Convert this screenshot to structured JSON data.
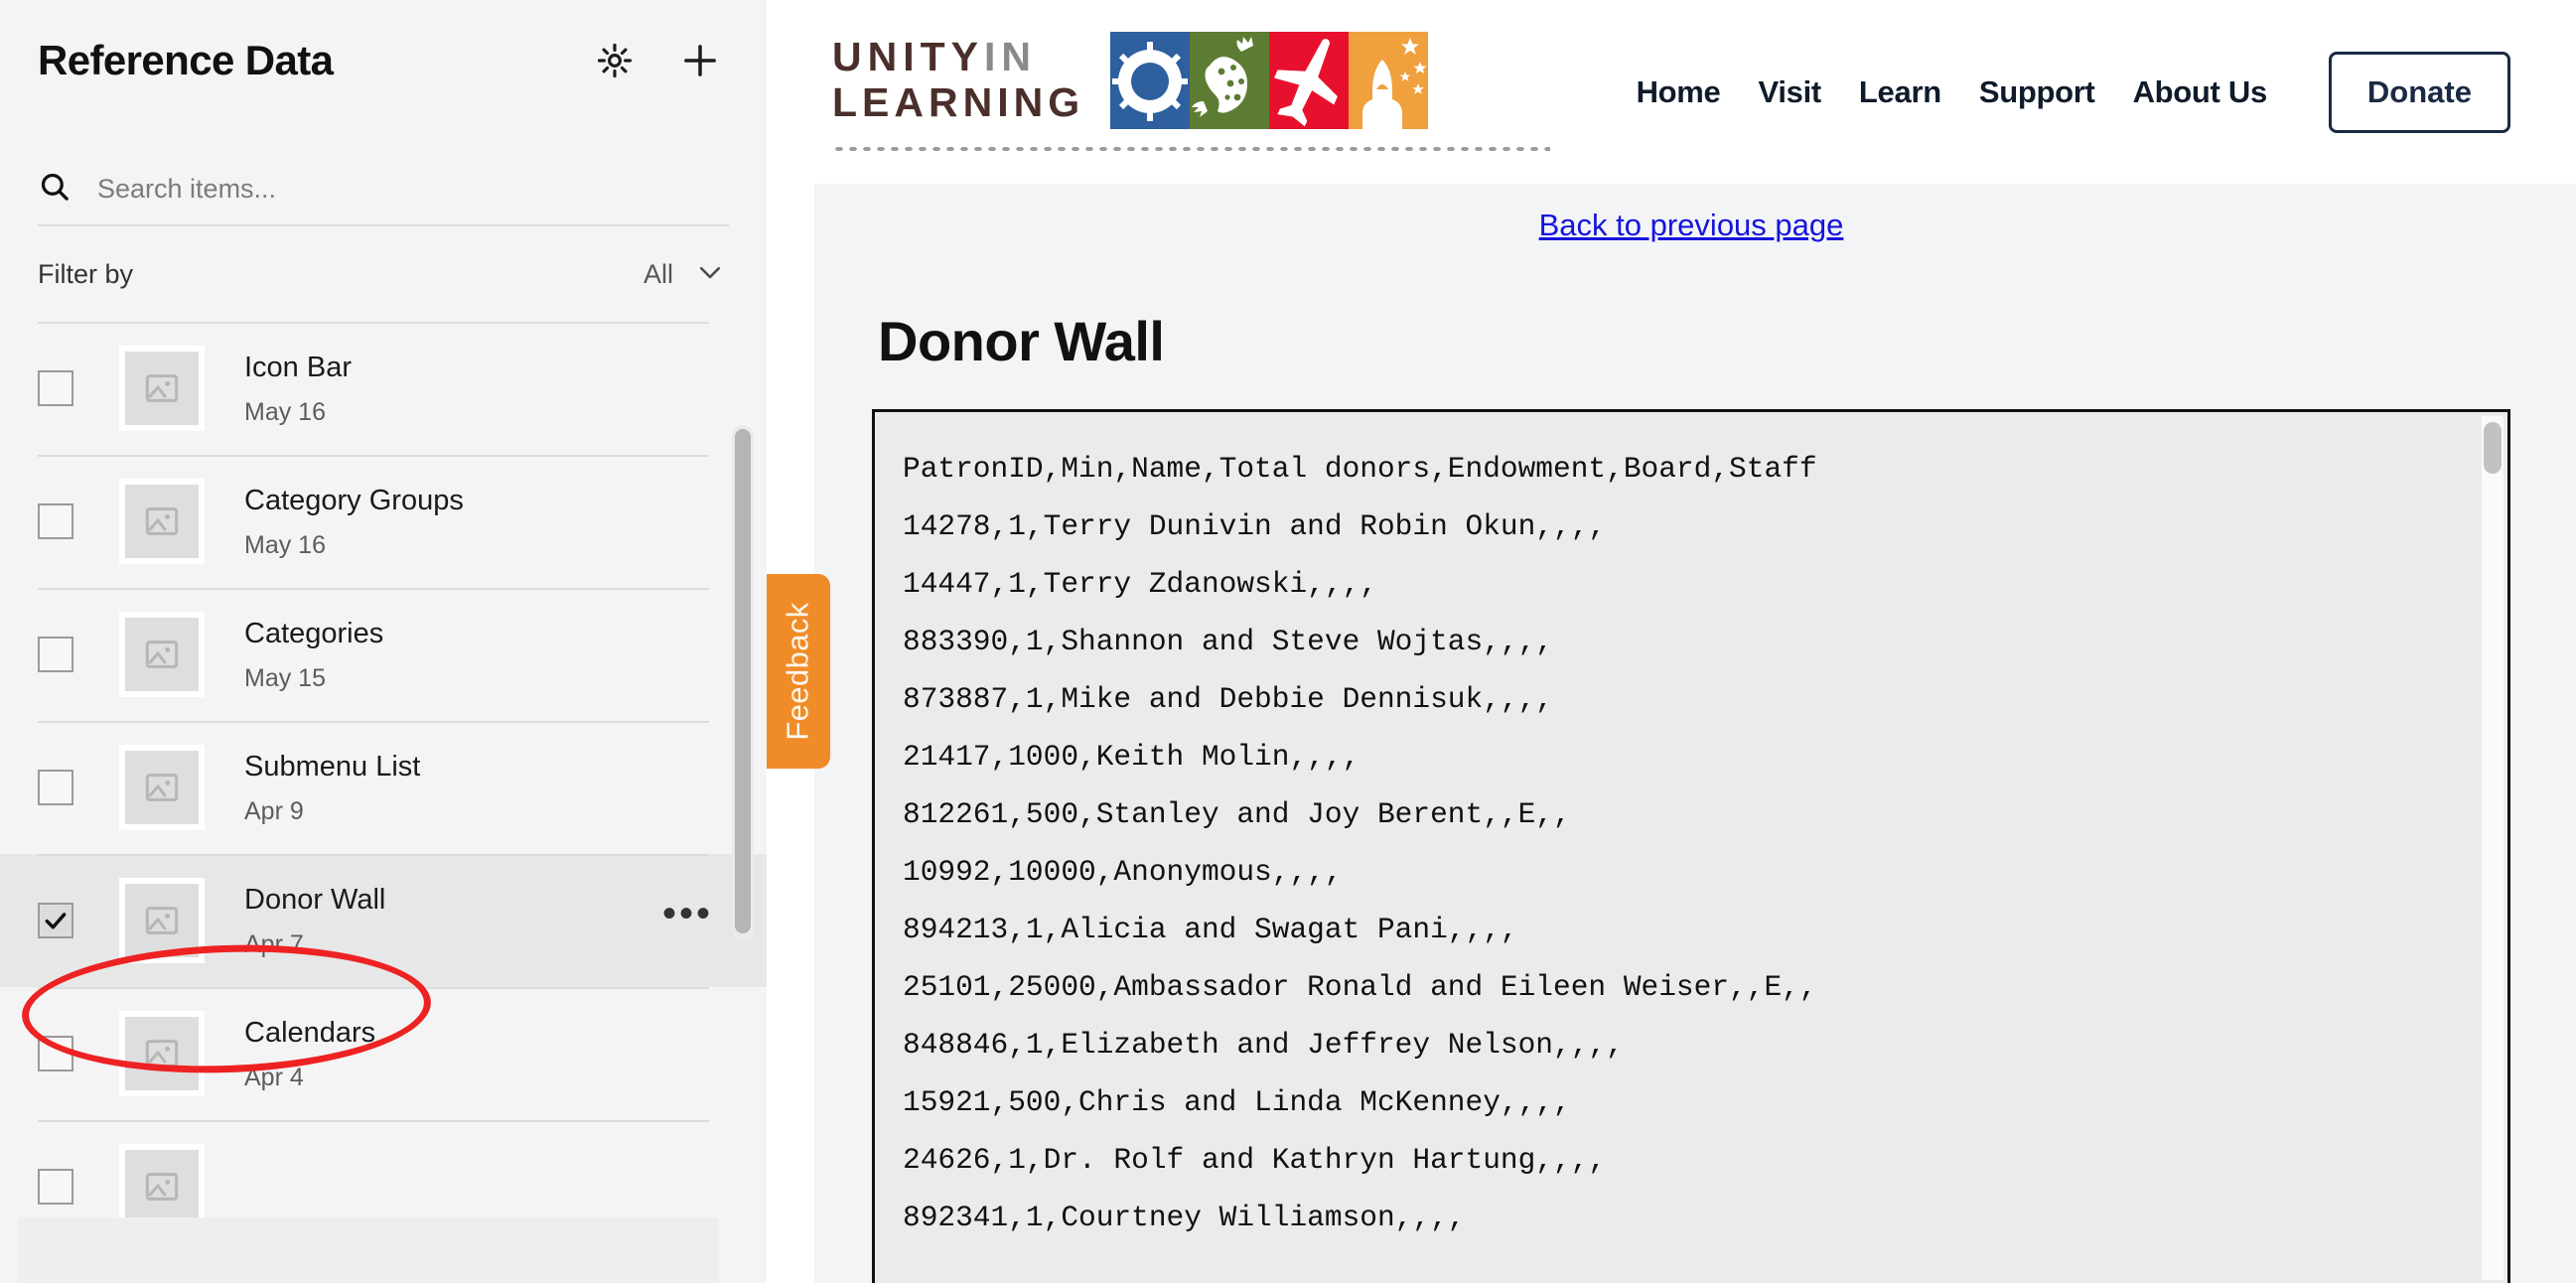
{
  "sidebar": {
    "title": "Reference Data",
    "icons": {
      "settings": "gear-icon",
      "add": "plus-icon"
    },
    "search": {
      "placeholder": "Search items...",
      "value": ""
    },
    "filter": {
      "label": "Filter by",
      "value": "All"
    },
    "items": [
      {
        "name": "Icon Bar",
        "date": "May 16",
        "checked": false,
        "selected": false
      },
      {
        "name": "Category Groups",
        "date": "May 16",
        "checked": false,
        "selected": false
      },
      {
        "name": "Categories",
        "date": "May 15",
        "checked": false,
        "selected": false
      },
      {
        "name": "Submenu List",
        "date": "Apr 9",
        "checked": false,
        "selected": false
      },
      {
        "name": "Donor Wall",
        "date": "Apr 7",
        "checked": true,
        "selected": true
      },
      {
        "name": "Calendars",
        "date": "Apr 4",
        "checked": false,
        "selected": false
      }
    ],
    "more_label": "•••",
    "check_glyph": "✔"
  },
  "site": {
    "logo": {
      "line1_main": "UNITY",
      "line1_dim": "IN",
      "line2": "LEARNING",
      "blocks": [
        "gear-sun-icon",
        "lizard-icon",
        "airplane-icon",
        "rocket-stars-icon"
      ],
      "colors": {
        "blue": "#2e5f9e",
        "green": "#5d7c33",
        "red": "#e8112d",
        "orange": "#f0a03c",
        "wordmark": "#4a2f2b"
      }
    },
    "nav": [
      {
        "label": "Home"
      },
      {
        "label": "Visit"
      },
      {
        "label": "Learn"
      },
      {
        "label": "Support"
      },
      {
        "label": "About Us"
      }
    ],
    "donate_label": "Donate"
  },
  "page": {
    "back_link": "Back to previous page",
    "title": "Donor Wall",
    "csv": "PatronID,Min,Name,Total donors,Endowment,Board,Staff\n14278,1,Terry Dunivin and Robin Okun,,,,\n14447,1,Terry Zdanowski,,,,\n883390,1,Shannon and Steve Wojtas,,,,\n873887,1,Mike and Debbie Dennisuk,,,,\n21417,1000,Keith Molin,,,,\n812261,500,Stanley and Joy Berent,,E,,\n10992,10000,Anonymous,,,,\n894213,1,Alicia and Swagat Pani,,,,\n25101,25000,Ambassador Ronald and Eileen Weiser,,E,,\n848846,1,Elizabeth and Jeffrey Nelson,,,,\n15921,500,Chris and Linda McKenney,,,,\n24626,1,Dr. Rolf and Kathryn Hartung,,,,\n892341,1,Courtney Williamson,,,,"
  },
  "feedback": {
    "label": "Feedback",
    "color": "#f08c28"
  },
  "annotation": {
    "shape": "ellipse",
    "color": "#ee2222",
    "target": "Donor Wall"
  }
}
